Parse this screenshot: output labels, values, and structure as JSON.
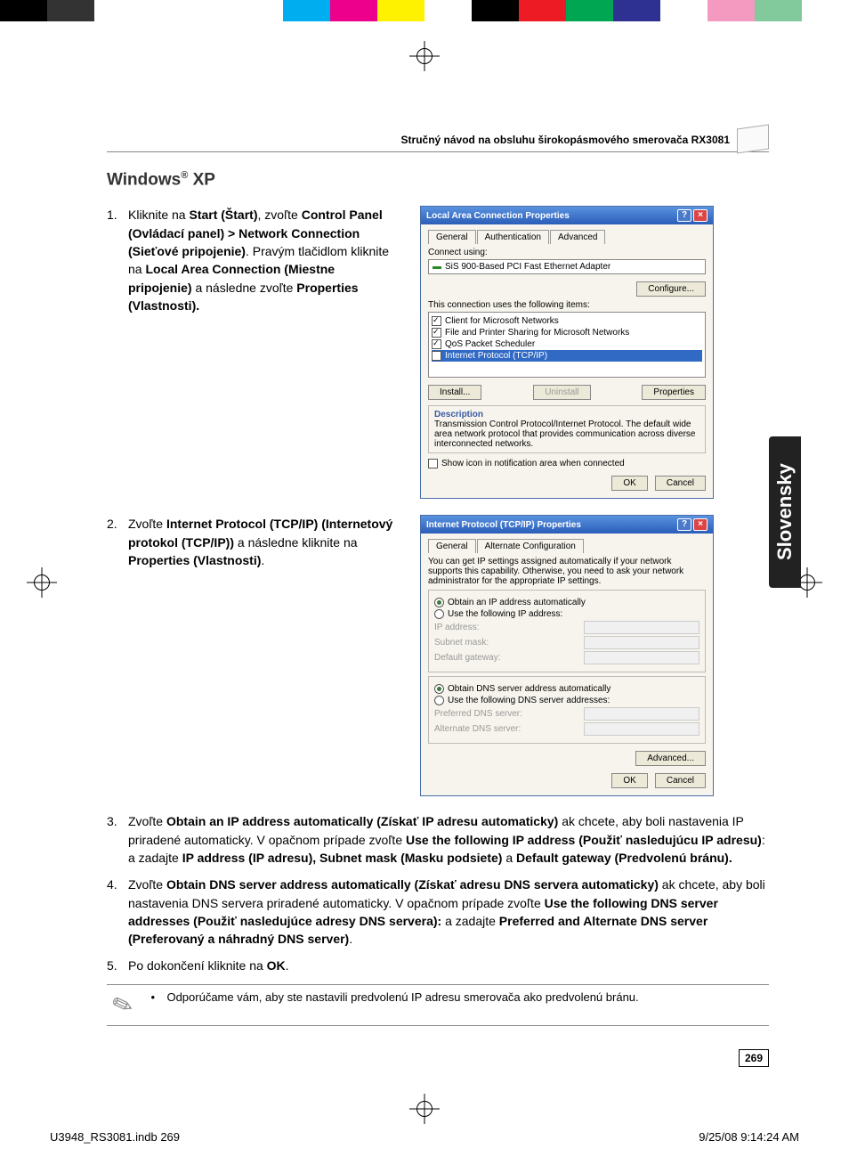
{
  "colorbar": [
    "#000",
    "#333",
    "#fff",
    "#fff",
    "#fff",
    "#fff",
    "#00adef",
    "#ec008c",
    "#fff200",
    "#fff",
    "#000",
    "#ed1c24",
    "#00a651",
    "#2e3192",
    "#fff",
    "#f49ac1",
    "#82ca9c",
    "#fff"
  ],
  "running_head": "Stručný návod na obsluhu širokopásmového smerovača RX3081",
  "section_title_pre": "Windows",
  "section_title_sup": "®",
  "section_title_post": " XP",
  "side_tab": "Slovensky",
  "page_number": "269",
  "footer_left": "U3948_RS3081.indb   269",
  "footer_right": "9/25/08   9:14:24 AM",
  "steps": {
    "s1_num": "1.",
    "s1": "Kliknite na <b>Start (Štart)</b>, zvoľte <b>Control Panel (Ovládací panel) > Network Connection (Sieťové pripojenie)</b>. Pravým tlačidlom kliknite na <b>Local Area Connection (Miestne pripojenie)</b> a následne zvoľte <b>Properties (Vlastnosti).</b>",
    "s2_num": "2.",
    "s2": "Zvoľte <b>Internet Protocol (TCP/IP) (Internetový protokol (TCP/IP))</b> a následne kliknite na <b>Properties (Vlastnosti)</b>.",
    "s3_num": "3.",
    "s3": "Zvoľte <b>Obtain an IP address automatically (Získať IP adresu automaticky)</b> ak chcete, aby boli nastavenia IP priradené automaticky. V opačnom prípade zvoľte <b>Use the following IP address (Použiť nasledujúcu IP adresu)</b>: a zadajte <b>IP address (IP adresu), Subnet mask (Masku podsiete)</b> a <b>Default gateway (Predvolenú bránu).</b>",
    "s4_num": "4.",
    "s4": "Zvoľte <b>Obtain DNS server address automatically (Získať adresu DNS servera automaticky)</b> ak chcete, aby boli nastavenia DNS servera priradené automaticky. V opačnom prípade zvoľte <b>Use the following DNS server addresses (Použiť nasledujúce adresy DNS servera):</b> a zadajte <b>Preferred and Alternate DNS server (Preferovaný a náhradný DNS server)</b>.",
    "s5_num": "5.",
    "s5": "Po dokončení kliknite na <b>OK</b>."
  },
  "note": "Odporúčame vám, aby ste nastavili predvolenú IP adresu smerovača ako predvolenú bránu.",
  "dlg1": {
    "title": "Local Area Connection Properties",
    "tabs": [
      "General",
      "Authentication",
      "Advanced"
    ],
    "connect_using_lbl": "Connect using:",
    "adapter": "SiS 900-Based PCI Fast Ethernet Adapter",
    "configure": "Configure...",
    "uses_lbl": "This connection uses the following items:",
    "items": [
      "Client for Microsoft Networks",
      "File and Printer Sharing for Microsoft Networks",
      "QoS Packet Scheduler",
      "Internet Protocol (TCP/IP)"
    ],
    "install": "Install...",
    "uninstall": "Uninstall",
    "properties": "Properties",
    "desc_h": "Description",
    "desc": "Transmission Control Protocol/Internet Protocol. The default wide area network protocol that provides communication across diverse interconnected networks.",
    "show_icon": "Show icon in notification area when connected",
    "ok": "OK",
    "cancel": "Cancel"
  },
  "dlg2": {
    "title": "Internet Protocol (TCP/IP) Properties",
    "tabs": [
      "General",
      "Alternate Configuration"
    ],
    "blurb": "You can get IP settings assigned automatically if your network supports this capability. Otherwise, you need to ask your network administrator for the appropriate IP settings.",
    "opt_auto_ip": "Obtain an IP address automatically",
    "opt_use_ip": "Use the following IP address:",
    "ip_label": "IP address:",
    "subnet_label": "Subnet mask:",
    "gw_label": "Default gateway:",
    "opt_auto_dns": "Obtain DNS server address automatically",
    "opt_use_dns": "Use the following DNS server addresses:",
    "pref_dns": "Preferred DNS server:",
    "alt_dns": "Alternate DNS server:",
    "advanced": "Advanced...",
    "ok": "OK",
    "cancel": "Cancel"
  }
}
